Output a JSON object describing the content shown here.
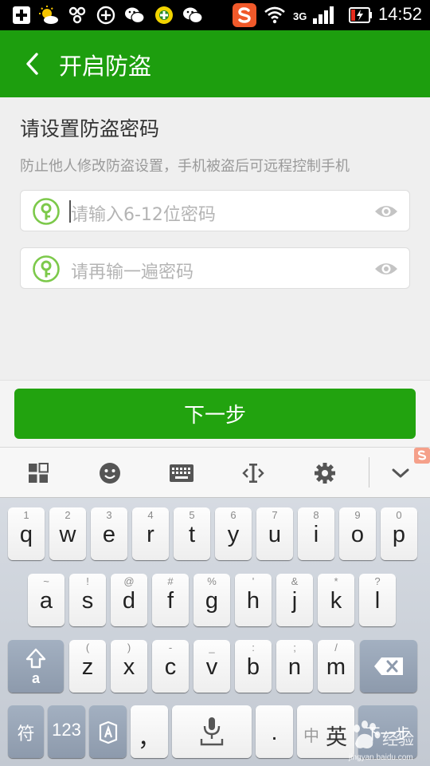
{
  "status_bar": {
    "network": "3G",
    "time": "14:52"
  },
  "app_bar": {
    "title": "开启防盗"
  },
  "form": {
    "heading": "请设置防盗密码",
    "description": "防止他人修改防盗设置，手机被盗后可远程控制手机",
    "password_placeholder": "请输入6-12位密码",
    "confirm_placeholder": "请再输一遍密码"
  },
  "next_button": {
    "label": "下一步"
  },
  "colors": {
    "brand_green": "#1d9e0e",
    "button_green": "#22a30f",
    "key_icon_green": "#7cc94a"
  },
  "keyboard": {
    "toolbar_icons": [
      "grid-icon",
      "smiley-icon",
      "keyboard-icon",
      "cursor-move-icon",
      "gear-icon",
      "chevron-down-icon"
    ],
    "row1": [
      {
        "hint": "1",
        "key": "q"
      },
      {
        "hint": "2",
        "key": "w"
      },
      {
        "hint": "3",
        "key": "e"
      },
      {
        "hint": "4",
        "key": "r"
      },
      {
        "hint": "5",
        "key": "t"
      },
      {
        "hint": "6",
        "key": "y"
      },
      {
        "hint": "7",
        "key": "u"
      },
      {
        "hint": "8",
        "key": "i"
      },
      {
        "hint": "9",
        "key": "o"
      },
      {
        "hint": "0",
        "key": "p"
      }
    ],
    "row2": [
      {
        "hint": "~",
        "key": "a"
      },
      {
        "hint": "!",
        "key": "s"
      },
      {
        "hint": "@",
        "key": "d"
      },
      {
        "hint": "#",
        "key": "f"
      },
      {
        "hint": "%",
        "key": "g"
      },
      {
        "hint": "'",
        "key": "h"
      },
      {
        "hint": "&",
        "key": "j"
      },
      {
        "hint": "*",
        "key": "k"
      },
      {
        "hint": "?",
        "key": "l"
      }
    ],
    "row3": [
      {
        "hint": "(",
        "key": "z"
      },
      {
        "hint": ")",
        "key": "x"
      },
      {
        "hint": "-",
        "key": "c"
      },
      {
        "hint": "_",
        "key": "v"
      },
      {
        "hint": ":",
        "key": "b"
      },
      {
        "hint": ";",
        "key": "n"
      },
      {
        "hint": "/",
        "key": "m"
      }
    ],
    "shift_label": "a",
    "symbols_label": "符",
    "numbers_label": "123",
    "comma_label": "，",
    "period_label": ".",
    "lang_zh": "中",
    "lang_en": "英",
    "enter_label": "下一步"
  },
  "watermark": {
    "text": "经验",
    "url": "jingyan.baidu.com"
  }
}
